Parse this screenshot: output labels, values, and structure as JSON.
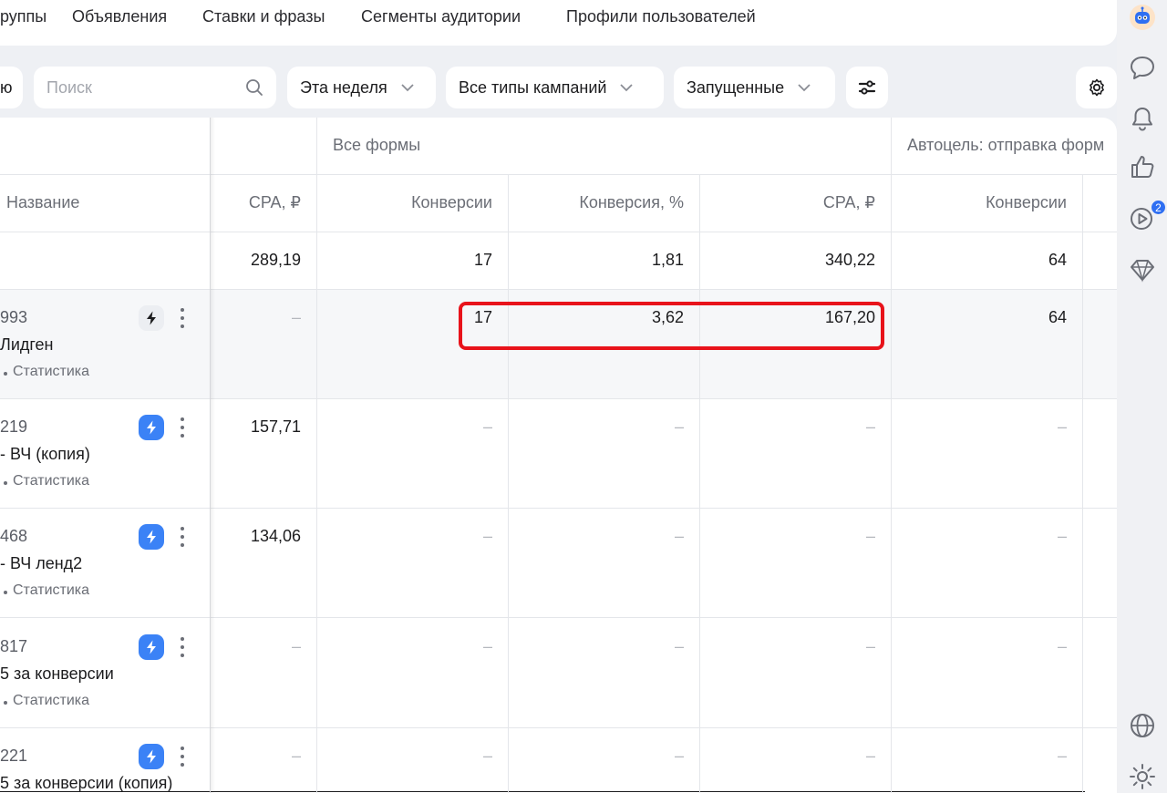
{
  "tabs": [
    "руппы",
    "Объявления",
    "Ставки и фразы",
    "Сегменты аудитории",
    "Профили пользователей"
  ],
  "filters": {
    "left_cut": "ю",
    "search_placeholder": "Поиск",
    "period": "Эта неделя",
    "campaign_types": "Все типы кампаний",
    "status": "Запущенные"
  },
  "table": {
    "group_headers": {
      "all_forms": "Все формы",
      "autogoal": "Автоцель: отправка форм"
    },
    "columns": {
      "name": "Название",
      "cpa_prev": "CPA, ₽",
      "conversions": "Конверсии",
      "conversion_rate": "Конверсия, %",
      "cpa": "CPA, ₽",
      "autogoal_conversions": "Конверсии"
    },
    "totals": {
      "cpa_prev": "289,19",
      "conversions": "17",
      "conversion_rate": "1,81",
      "cpa": "340,22",
      "autogoal_conversions": "64"
    },
    "rows": [
      {
        "id": "993",
        "name": "Лидген",
        "stat": "Статистика",
        "cpa_prev": "–",
        "conversions": "17",
        "conversion_rate": "3,62",
        "cpa": "167,20",
        "autogoal_conversions": "64",
        "bolt_active": false
      },
      {
        "id": "219",
        "name": "- ВЧ (копия)",
        "stat": "Статистика",
        "cpa_prev": "157,71",
        "conversions": "–",
        "conversion_rate": "–",
        "cpa": "–",
        "autogoal_conversions": "–",
        "bolt_active": true
      },
      {
        "id": "468",
        "name": "- ВЧ ленд2",
        "stat": "Статистика",
        "cpa_prev": "134,06",
        "conversions": "–",
        "conversion_rate": "–",
        "cpa": "–",
        "autogoal_conversions": "–",
        "bolt_active": true
      },
      {
        "id": "817",
        "name": "5 за конверсии",
        "stat": "Статистика",
        "cpa_prev": "–",
        "conversions": "–",
        "conversion_rate": "–",
        "cpa": "–",
        "autogoal_conversions": "–",
        "bolt_active": true
      },
      {
        "id": "221",
        "name": "5 за конверсии (копия)",
        "stat": "",
        "cpa_prev": "–",
        "conversions": "–",
        "conversion_rate": "–",
        "cpa": "–",
        "autogoal_conversions": "–",
        "bolt_active": true
      }
    ]
  },
  "rail": {
    "badge_count": "2"
  },
  "colors": {
    "accent": "#3b82f6",
    "highlight": "#e8131b",
    "badge": "#2f6ff2"
  }
}
